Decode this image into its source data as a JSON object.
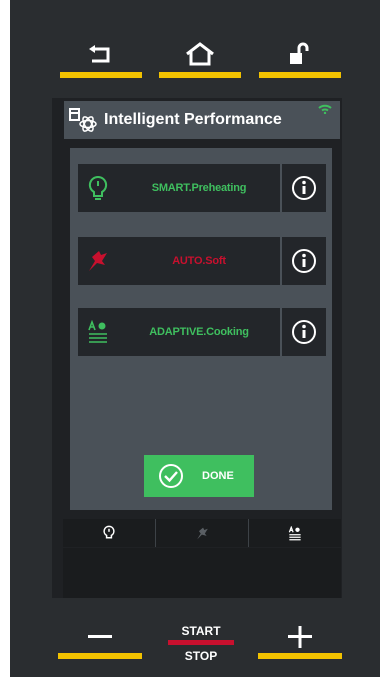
{
  "header": {
    "back_icon": "back-arrow-icon",
    "home_icon": "home-icon",
    "lock_icon": "unlock-icon"
  },
  "panel": {
    "title": "Intelligent Performance",
    "title_icon": "oven-atom-icon",
    "wifi_icon": "wifi-icon"
  },
  "features": [
    {
      "label": "SMART.Preheating",
      "icon": "bulb-power-icon",
      "color": "#3fbf5f"
    },
    {
      "label": "AUTO.Soft",
      "icon": "auto-soft-icon",
      "color": "#c8102e"
    },
    {
      "label": "ADAPTIVE.Cooking",
      "icon": "adaptive-cooking-icon",
      "color": "#3fbf5f"
    }
  ],
  "done_label": "DONE",
  "tabs": [
    {
      "icon": "bulb-power-icon",
      "active": true
    },
    {
      "icon": "auto-soft-icon",
      "active": false
    },
    {
      "icon": "adaptive-cooking-icon",
      "active": true
    }
  ],
  "controls": {
    "start_label": "START",
    "stop_label": "STOP",
    "minus_icon": "minus-icon",
    "plus_icon": "plus-icon"
  },
  "colors": {
    "accent_yellow": "#f2c200",
    "green": "#3fbf5f",
    "red": "#c8102e"
  }
}
